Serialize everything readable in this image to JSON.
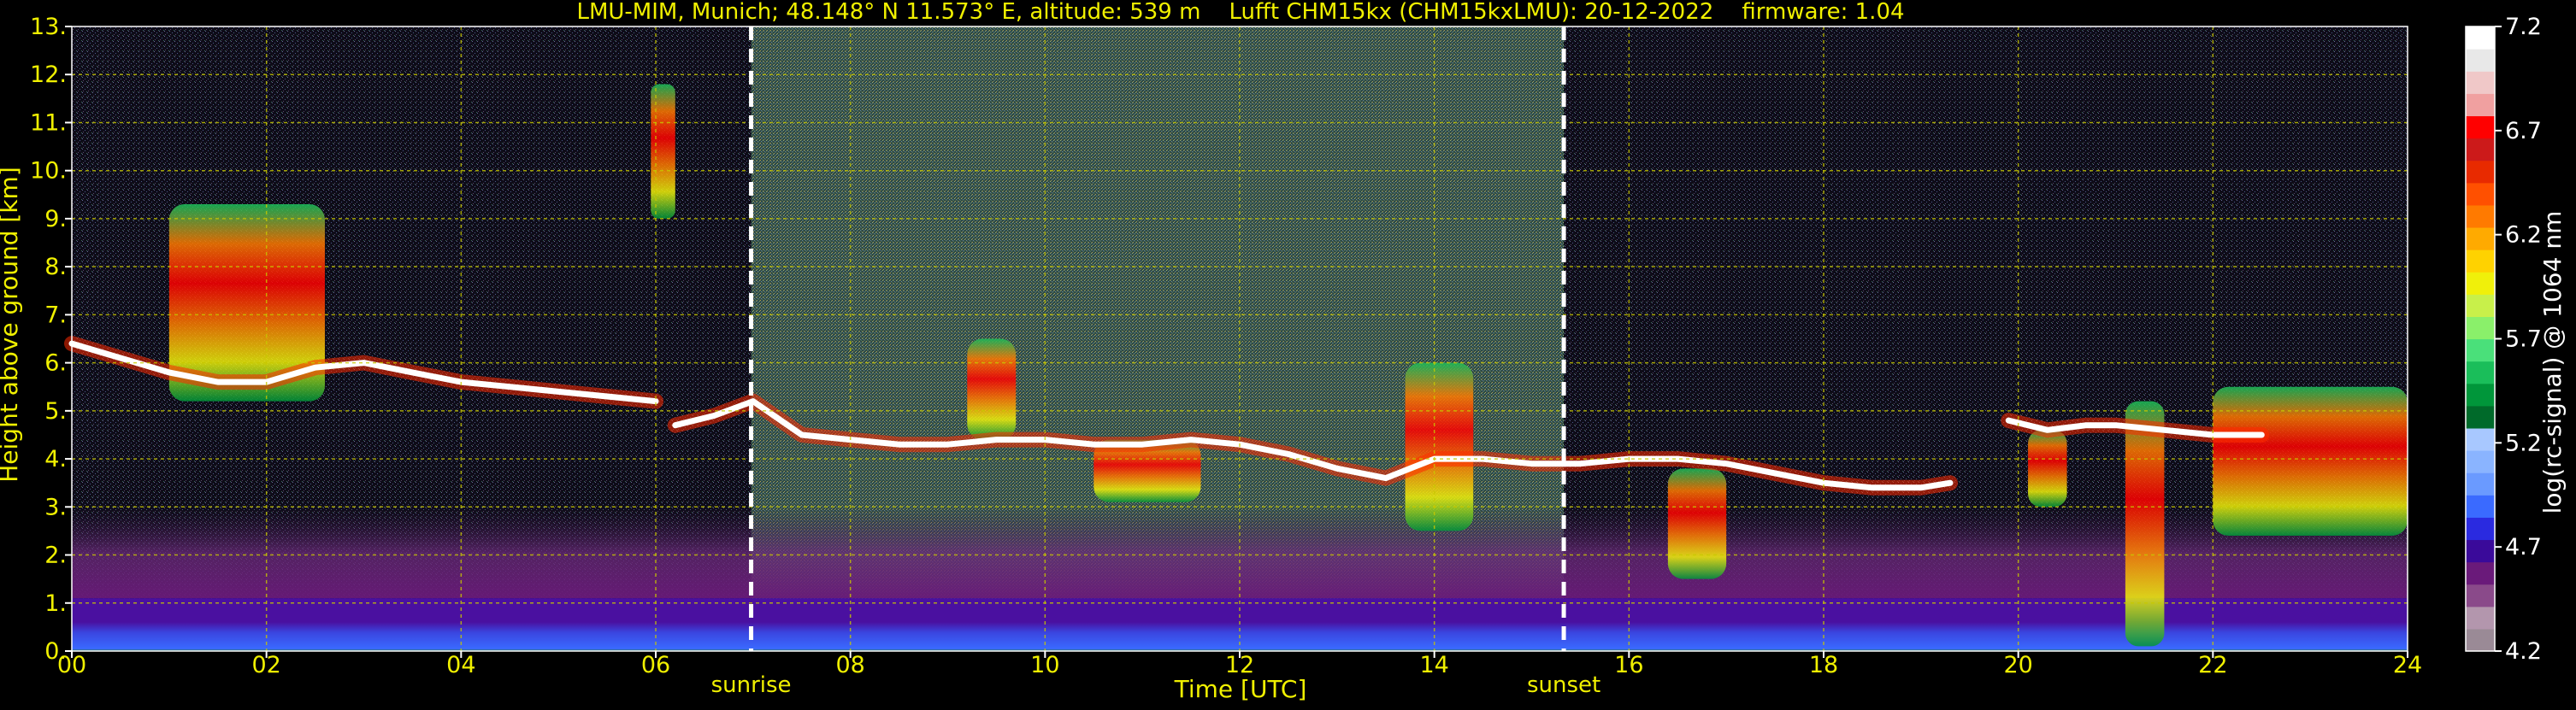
{
  "chart_data": {
    "type": "heatmap",
    "title": "LMU-MIM, Munich; 48.148° N 11.573° E, altitude: 539 m    Lufft CHM15kx (CHM15kxLMU): 20-12-2022    firmware: 1.04",
    "xlabel": "Time [UTC]",
    "ylabel": "Height above ground [km]",
    "colorbar_label": "log(rc-signal) @ 1064 nm",
    "xlim": [
      0,
      24
    ],
    "ylim": [
      0,
      13
    ],
    "x_ticks": [
      0,
      2,
      4,
      6,
      8,
      10,
      12,
      14,
      16,
      18,
      20,
      22,
      24
    ],
    "x_tick_labels": [
      "00",
      "02",
      "04",
      "06",
      "08",
      "10",
      "12",
      "14",
      "16",
      "18",
      "20",
      "22",
      "24"
    ],
    "y_ticks": [
      0,
      1,
      2,
      3,
      4,
      5,
      6,
      7,
      8,
      9,
      10,
      11,
      12,
      13
    ],
    "y_tick_labels": [
      "0.",
      "1.",
      "2.",
      "3.",
      "4.",
      "5.",
      "6.",
      "7.",
      "8.",
      "9.",
      "10.",
      "11.",
      "12.",
      "13."
    ],
    "grid": true,
    "colorbar": {
      "range": [
        4.2,
        7.2
      ],
      "tick_values": [
        4.2,
        4.7,
        5.2,
        5.7,
        6.2,
        6.7,
        7.2
      ],
      "tick_labels": [
        "4.2",
        "4.7",
        "5.2",
        "5.7",
        "6.2",
        "6.7",
        "7.2"
      ],
      "colors": [
        "#9a8a96",
        "#b396ad",
        "#8a4a8a",
        "#6a1a7a",
        "#3a0a9a",
        "#2a2ae0",
        "#3a6aff",
        "#6a9aff",
        "#8ab4ff",
        "#a8c8ff",
        "#006a2a",
        "#00963a",
        "#1abe5a",
        "#4ae07a",
        "#8af06a",
        "#c8f04a",
        "#f0f00a",
        "#ffd200",
        "#ffaa00",
        "#ff7a00",
        "#ff5000",
        "#e82a00",
        "#cc1a1a",
        "#ff0000",
        "#f0a0a0",
        "#f0c8c8",
        "#e8e8e8",
        "#ffffff"
      ]
    },
    "events": [
      {
        "label": "sunrise",
        "time": 6.98
      },
      {
        "label": "sunset",
        "time": 15.33
      }
    ],
    "colors": {
      "text": "#f0f000",
      "colorbar_text": "#ffffff",
      "grid": "#c8c800",
      "event_line": "#ffffff",
      "background": "#000000",
      "noise_day": "#3a5a4a",
      "noise_night": "#14121e"
    },
    "layers": [
      {
        "name": "cloud-base",
        "points": [
          [
            0,
            6.4
          ],
          [
            0.5,
            6.1
          ],
          [
            1,
            5.8
          ],
          [
            1.5,
            5.6
          ],
          [
            2,
            5.6
          ],
          [
            2.5,
            5.9
          ],
          [
            3,
            6.0
          ],
          [
            3.5,
            5.8
          ],
          [
            4,
            5.6
          ],
          [
            4.5,
            5.5
          ],
          [
            5,
            5.4
          ],
          [
            5.5,
            5.3
          ],
          [
            6,
            5.2
          ]
        ]
      },
      {
        "name": "cloud-base",
        "points": [
          [
            6.2,
            4.7
          ],
          [
            6.6,
            4.9
          ],
          [
            7,
            5.2
          ],
          [
            7.5,
            4.5
          ],
          [
            8,
            4.4
          ],
          [
            8.5,
            4.3
          ],
          [
            9,
            4.3
          ],
          [
            9.5,
            4.4
          ],
          [
            10,
            4.4
          ],
          [
            10.5,
            4.3
          ],
          [
            11,
            4.3
          ],
          [
            11.5,
            4.4
          ],
          [
            12,
            4.3
          ],
          [
            12.5,
            4.1
          ],
          [
            13,
            3.8
          ],
          [
            13.5,
            3.6
          ],
          [
            14,
            4.0
          ],
          [
            14.5,
            4.0
          ],
          [
            15,
            3.9
          ],
          [
            15.5,
            3.9
          ],
          [
            16,
            4.0
          ],
          [
            16.5,
            4.0
          ],
          [
            17,
            3.9
          ],
          [
            17.5,
            3.7
          ],
          [
            18,
            3.5
          ],
          [
            18.5,
            3.4
          ],
          [
            19,
            3.4
          ],
          [
            19.3,
            3.5
          ]
        ]
      },
      {
        "name": "cloud-base",
        "points": [
          [
            19.9,
            4.8
          ],
          [
            20.3,
            4.6
          ],
          [
            20.7,
            4.7
          ],
          [
            21,
            4.7
          ],
          [
            21.5,
            4.6
          ],
          [
            22,
            4.5
          ],
          [
            22.5,
            4.5
          ]
        ]
      }
    ],
    "cirrus_patches": [
      {
        "t0": 1.0,
        "t1": 2.6,
        "z0": 5.2,
        "z1": 9.3
      },
      {
        "t0": 5.95,
        "t1": 6.2,
        "z0": 9.0,
        "z1": 11.8
      },
      {
        "t0": 9.2,
        "t1": 9.7,
        "z0": 4.4,
        "z1": 6.5
      },
      {
        "t0": 10.5,
        "t1": 11.6,
        "z0": 3.1,
        "z1": 4.4
      },
      {
        "t0": 13.7,
        "t1": 14.4,
        "z0": 2.5,
        "z1": 6.0
      },
      {
        "t0": 16.4,
        "t1": 17.0,
        "z0": 1.5,
        "z1": 3.8
      },
      {
        "t0": 20.1,
        "t1": 20.5,
        "z0": 3.0,
        "z1": 4.6
      },
      {
        "t0": 21.1,
        "t1": 21.5,
        "z0": 0.1,
        "z1": 5.2
      },
      {
        "t0": 22.0,
        "t1": 24.0,
        "z0": 2.4,
        "z1": 5.5
      }
    ],
    "boundary_layer": {
      "top_km": 1.1,
      "aerosol_top_km": 3.0
    }
  }
}
